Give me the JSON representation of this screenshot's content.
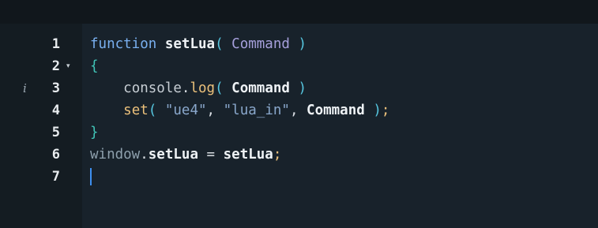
{
  "editor": {
    "line_numbers": [
      "1",
      "2",
      "3",
      "4",
      "5",
      "6",
      "7"
    ],
    "fold_marker": "▾",
    "info_marker": "i",
    "lines": [
      {
        "tokens": [
          "function",
          " ",
          "setLua",
          "(",
          " ",
          "Command",
          " ",
          ")"
        ]
      },
      {
        "tokens": [
          "{"
        ]
      },
      {
        "tokens": [
          "    ",
          "console",
          ".",
          "log",
          "(",
          " ",
          "Command",
          " ",
          ")"
        ]
      },
      {
        "tokens": [
          "    ",
          "set",
          "(",
          " ",
          "\"ue4\"",
          ",",
          " ",
          "\"lua_in\"",
          ",",
          " ",
          "Command",
          " ",
          ")",
          ";"
        ]
      },
      {
        "tokens": [
          "}"
        ]
      },
      {
        "tokens": [
          "window",
          ".",
          "setLua",
          " ",
          "=",
          " ",
          "setLua",
          ";"
        ]
      },
      {
        "tokens": []
      }
    ]
  },
  "colors": {
    "background": "#18222b",
    "keyword": "#79b0f0",
    "function_name": "#eef2f5",
    "paren": "#56c7e0",
    "parameter": "#a6a0dc",
    "brace": "#41c5b8",
    "method": "#ecc17b",
    "string": "#8aa8cc",
    "cursor": "#3e8ff0"
  }
}
